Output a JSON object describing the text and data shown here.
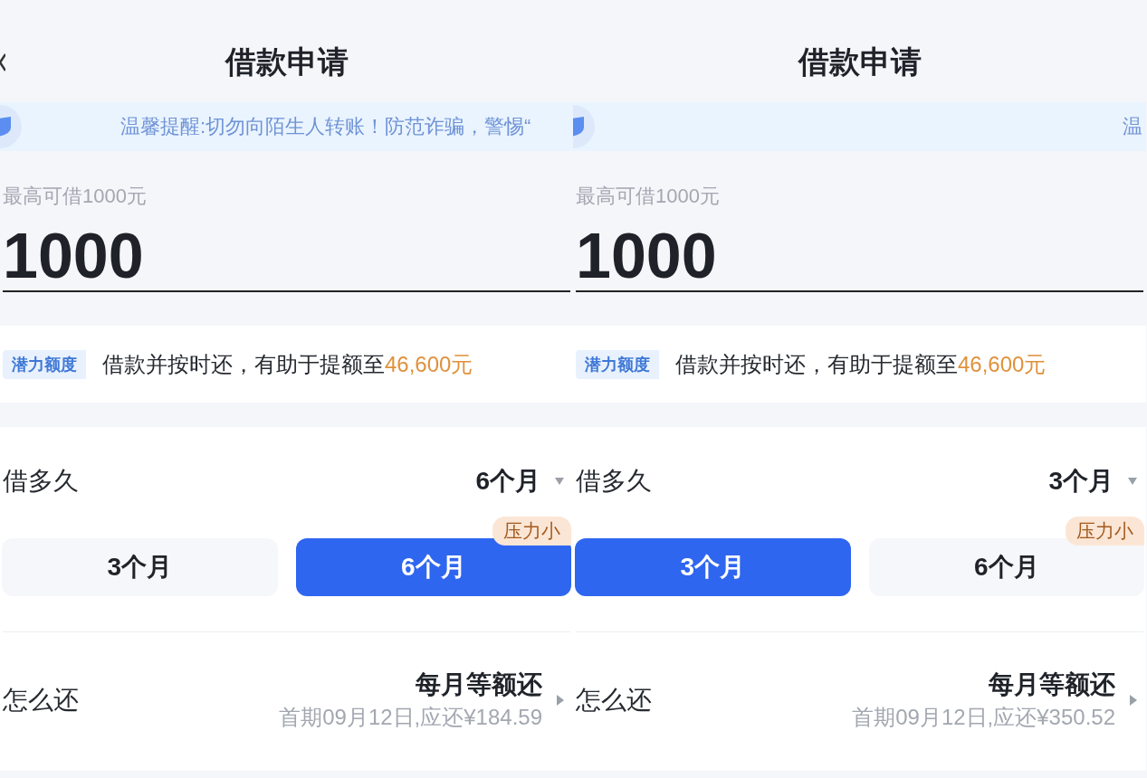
{
  "panels": [
    {
      "title": "借款申请",
      "back": true,
      "notice": "温馨提醒:切勿向陌生人转账！防范诈骗，警惕“",
      "max_label": "最高可借1000元",
      "amount": "1000",
      "tag": "潜力额度",
      "promo_text": "借款并按时还，有助于提额至",
      "promo_highlight": "46,600元",
      "term_label": "借多久",
      "term_value": "6个月",
      "term_options": [
        {
          "label": "3个月",
          "selected": false
        },
        {
          "label": "6个月",
          "selected": true,
          "badge": "压力小"
        }
      ],
      "repay_label": "怎么还",
      "repay_method": "每月等额还",
      "repay_detail": "首期09月12日,应还¥184.59"
    },
    {
      "title": "借款申请",
      "back": false,
      "notice": "温",
      "max_label": "最高可借1000元",
      "amount": "1000",
      "tag": "潜力额度",
      "promo_text": "借款并按时还，有助于提额至",
      "promo_highlight": "46,600元",
      "term_label": "借多久",
      "term_value": "3个月",
      "term_options": [
        {
          "label": "3个月",
          "selected": true
        },
        {
          "label": "6个月",
          "selected": false,
          "badge": "压力小"
        }
      ],
      "repay_label": "怎么还",
      "repay_method": "每月等额还",
      "repay_detail": "首期09月12日,应还¥350.52"
    }
  ]
}
